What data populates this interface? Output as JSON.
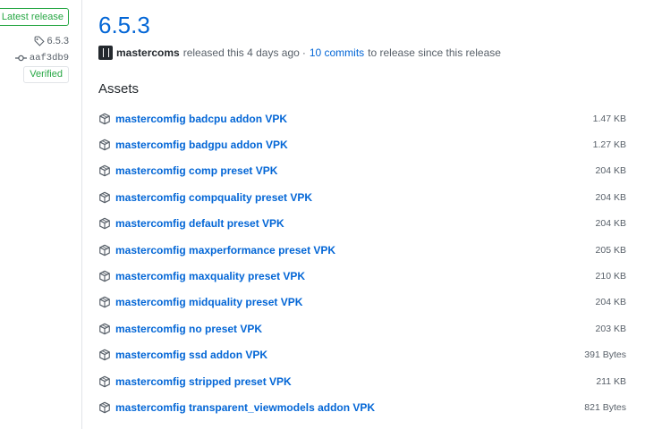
{
  "sidebar": {
    "latest_label": "Latest release",
    "tag": "6.5.3",
    "commit": "aaf3db9",
    "verified_label": "Verified"
  },
  "release": {
    "title": "6.5.3",
    "author": "mastercoms",
    "released_text": "released this 4 days ago",
    "separator": "·",
    "commits_link": "10 commits",
    "since_text": "to release since this release"
  },
  "assets": {
    "heading": "Assets",
    "items": [
      {
        "name": "mastercomfig badcpu addon VPK",
        "size": "1.47 KB"
      },
      {
        "name": "mastercomfig badgpu addon VPK",
        "size": "1.27 KB"
      },
      {
        "name": "mastercomfig comp preset VPK",
        "size": "204 KB"
      },
      {
        "name": "mastercomfig compquality preset VPK",
        "size": "204 KB"
      },
      {
        "name": "mastercomfig default preset VPK",
        "size": "204 KB"
      },
      {
        "name": "mastercomfig maxperformance preset VPK",
        "size": "205 KB"
      },
      {
        "name": "mastercomfig maxquality preset VPK",
        "size": "210 KB"
      },
      {
        "name": "mastercomfig midquality preset VPK",
        "size": "204 KB"
      },
      {
        "name": "mastercomfig no preset VPK",
        "size": "203 KB"
      },
      {
        "name": "mastercomfig ssd addon VPK",
        "size": "391 Bytes"
      },
      {
        "name": "mastercomfig stripped preset VPK",
        "size": "211 KB"
      },
      {
        "name": "mastercomfig transparent_viewmodels addon VPK",
        "size": "821 Bytes"
      }
    ]
  },
  "colors": {
    "link": "#0366d6",
    "success": "#28a745",
    "muted": "#586069"
  },
  "icons": {
    "tag": "tag-icon",
    "commit": "git-commit-icon",
    "package": "package-icon"
  }
}
